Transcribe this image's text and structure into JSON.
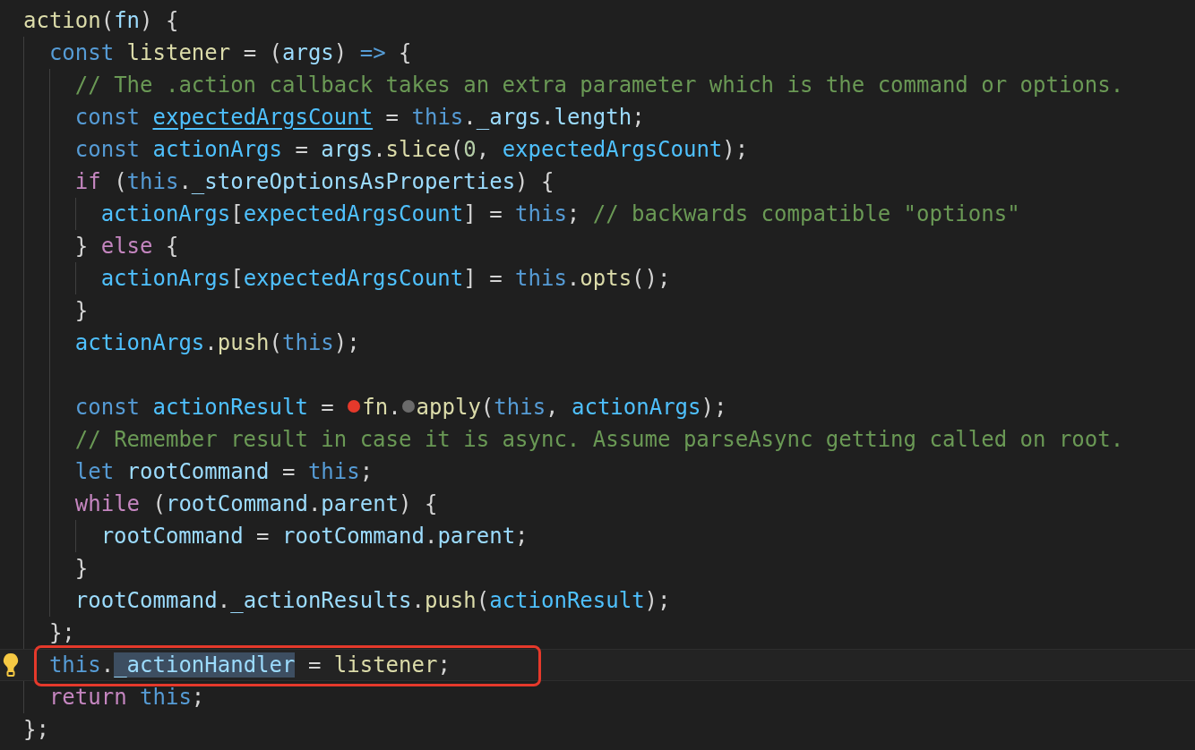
{
  "editor": {
    "lines": [
      {
        "tokens": [
          {
            "text": "action",
            "kind": "fn"
          },
          {
            "text": "(",
            "kind": "punc"
          },
          {
            "text": "fn",
            "kind": "var"
          },
          {
            "text": ") {",
            "kind": "punc"
          }
        ],
        "children": [
          {
            "tokens": [
              {
                "text": "const ",
                "kind": "kw"
              },
              {
                "text": "listener",
                "kind": "fn"
              },
              {
                "text": " = (",
                "kind": "punc"
              },
              {
                "text": "args",
                "kind": "var"
              },
              {
                "text": ") ",
                "kind": "punc"
              },
              {
                "text": "=>",
                "kind": "kw"
              },
              {
                "text": " {",
                "kind": "punc"
              }
            ],
            "children": [
              {
                "tokens": [
                  {
                    "text": "// The .action callback takes an extra parameter which is the command or options.",
                    "kind": "cmt"
                  }
                ]
              },
              {
                "tokens": [
                  {
                    "text": "const ",
                    "kind": "kw"
                  },
                  {
                    "text": "expectedArgsCount",
                    "kind": "const",
                    "underlined": true
                  },
                  {
                    "text": " = ",
                    "kind": "punc"
                  },
                  {
                    "text": "this",
                    "kind": "kw"
                  },
                  {
                    "text": ".",
                    "kind": "punc"
                  },
                  {
                    "text": "_args",
                    "kind": "var"
                  },
                  {
                    "text": ".",
                    "kind": "punc"
                  },
                  {
                    "text": "length",
                    "kind": "var"
                  },
                  {
                    "text": ";",
                    "kind": "punc"
                  }
                ]
              },
              {
                "tokens": [
                  {
                    "text": "const ",
                    "kind": "kw"
                  },
                  {
                    "text": "actionArgs",
                    "kind": "const"
                  },
                  {
                    "text": " = ",
                    "kind": "punc"
                  },
                  {
                    "text": "args",
                    "kind": "var"
                  },
                  {
                    "text": ".",
                    "kind": "punc"
                  },
                  {
                    "text": "slice",
                    "kind": "fn"
                  },
                  {
                    "text": "(",
                    "kind": "punc"
                  },
                  {
                    "text": "0",
                    "kind": "num"
                  },
                  {
                    "text": ", ",
                    "kind": "punc"
                  },
                  {
                    "text": "expectedArgsCount",
                    "kind": "const"
                  },
                  {
                    "text": ");",
                    "kind": "punc"
                  }
                ]
              },
              {
                "tokens": [
                  {
                    "text": "if",
                    "kind": "ctl"
                  },
                  {
                    "text": " (",
                    "kind": "punc"
                  },
                  {
                    "text": "this",
                    "kind": "kw"
                  },
                  {
                    "text": ".",
                    "kind": "punc"
                  },
                  {
                    "text": "_storeOptionsAsProperties",
                    "kind": "var"
                  },
                  {
                    "text": ") {",
                    "kind": "punc"
                  }
                ],
                "children": [
                  {
                    "tokens": [
                      {
                        "text": "actionArgs",
                        "kind": "const"
                      },
                      {
                        "text": "[",
                        "kind": "punc"
                      },
                      {
                        "text": "expectedArgsCount",
                        "kind": "const"
                      },
                      {
                        "text": "] = ",
                        "kind": "punc"
                      },
                      {
                        "text": "this",
                        "kind": "kw"
                      },
                      {
                        "text": "; ",
                        "kind": "punc"
                      },
                      {
                        "text": "// backwards compatible \"options\"",
                        "kind": "cmt"
                      }
                    ]
                  }
                ]
              },
              {
                "tokens": [
                  {
                    "text": "} ",
                    "kind": "punc"
                  },
                  {
                    "text": "else",
                    "kind": "ctl"
                  },
                  {
                    "text": " {",
                    "kind": "punc"
                  }
                ],
                "children": [
                  {
                    "tokens": [
                      {
                        "text": "actionArgs",
                        "kind": "const"
                      },
                      {
                        "text": "[",
                        "kind": "punc"
                      },
                      {
                        "text": "expectedArgsCount",
                        "kind": "const"
                      },
                      {
                        "text": "] = ",
                        "kind": "punc"
                      },
                      {
                        "text": "this",
                        "kind": "kw"
                      },
                      {
                        "text": ".",
                        "kind": "punc"
                      },
                      {
                        "text": "opts",
                        "kind": "fn"
                      },
                      {
                        "text": "();",
                        "kind": "punc"
                      }
                    ]
                  }
                ]
              },
              {
                "tokens": [
                  {
                    "text": "}",
                    "kind": "punc"
                  }
                ]
              },
              {
                "tokens": [
                  {
                    "text": "actionArgs",
                    "kind": "const"
                  },
                  {
                    "text": ".",
                    "kind": "punc"
                  },
                  {
                    "text": "push",
                    "kind": "fn"
                  },
                  {
                    "text": "(",
                    "kind": "punc"
                  },
                  {
                    "text": "this",
                    "kind": "kw"
                  },
                  {
                    "text": ");",
                    "kind": "punc"
                  }
                ]
              },
              {
                "blank": true
              },
              {
                "tokens": [
                  {
                    "text": "const ",
                    "kind": "kw"
                  },
                  {
                    "text": "actionResult",
                    "kind": "const"
                  },
                  {
                    "text": " = ",
                    "kind": "punc"
                  },
                  {
                    "kind": "marker",
                    "color": "#e5392b"
                  },
                  {
                    "text": "fn",
                    "kind": "fn"
                  },
                  {
                    "text": ".",
                    "kind": "punc"
                  },
                  {
                    "kind": "marker",
                    "color": "#6b6b6b"
                  },
                  {
                    "text": "apply",
                    "kind": "fn"
                  },
                  {
                    "text": "(",
                    "kind": "punc"
                  },
                  {
                    "text": "this",
                    "kind": "kw"
                  },
                  {
                    "text": ", ",
                    "kind": "punc"
                  },
                  {
                    "text": "actionArgs",
                    "kind": "const"
                  },
                  {
                    "text": ");",
                    "kind": "punc"
                  }
                ]
              },
              {
                "tokens": [
                  {
                    "text": "// Remember result in case it is async. Assume parseAsync getting called on root.",
                    "kind": "cmt"
                  }
                ]
              },
              {
                "tokens": [
                  {
                    "text": "let ",
                    "kind": "kw"
                  },
                  {
                    "text": "rootCommand",
                    "kind": "var"
                  },
                  {
                    "text": " = ",
                    "kind": "punc"
                  },
                  {
                    "text": "this",
                    "kind": "kw"
                  },
                  {
                    "text": ";",
                    "kind": "punc"
                  }
                ]
              },
              {
                "tokens": [
                  {
                    "text": "while",
                    "kind": "ctl"
                  },
                  {
                    "text": " (",
                    "kind": "punc"
                  },
                  {
                    "text": "rootCommand",
                    "kind": "var"
                  },
                  {
                    "text": ".",
                    "kind": "punc"
                  },
                  {
                    "text": "parent",
                    "kind": "var"
                  },
                  {
                    "text": ") {",
                    "kind": "punc"
                  }
                ],
                "children": [
                  {
                    "tokens": [
                      {
                        "text": "rootCommand",
                        "kind": "var"
                      },
                      {
                        "text": " = ",
                        "kind": "punc"
                      },
                      {
                        "text": "rootCommand",
                        "kind": "var"
                      },
                      {
                        "text": ".",
                        "kind": "punc"
                      },
                      {
                        "text": "parent",
                        "kind": "var"
                      },
                      {
                        "text": ";",
                        "kind": "punc"
                      }
                    ]
                  }
                ]
              },
              {
                "tokens": [
                  {
                    "text": "}",
                    "kind": "punc"
                  }
                ]
              },
              {
                "tokens": [
                  {
                    "text": "rootCommand",
                    "kind": "var"
                  },
                  {
                    "text": ".",
                    "kind": "punc"
                  },
                  {
                    "text": "_actionResults",
                    "kind": "var"
                  },
                  {
                    "text": ".",
                    "kind": "punc"
                  },
                  {
                    "text": "push",
                    "kind": "fn"
                  },
                  {
                    "text": "(",
                    "kind": "punc"
                  },
                  {
                    "text": "actionResult",
                    "kind": "const"
                  },
                  {
                    "text": ");",
                    "kind": "punc"
                  }
                ]
              }
            ]
          },
          {
            "tokens": [
              {
                "text": "};",
                "kind": "punc"
              }
            ]
          },
          {
            "current": true,
            "lightbulb": true,
            "annotated": true,
            "tokens": [
              {
                "text": "this",
                "kind": "kw",
                "selected": false
              },
              {
                "text": ".",
                "kind": "punc",
                "selected": false
              },
              {
                "text": "_actionHandler",
                "kind": "var",
                "selected": true
              },
              {
                "text": " = ",
                "kind": "punc",
                "selected": false
              },
              {
                "text": "listener",
                "kind": "fn",
                "selected": false
              },
              {
                "text": ";",
                "kind": "punc",
                "selected": false
              }
            ]
          },
          {
            "tokens": [
              {
                "text": "return ",
                "kind": "ctl"
              },
              {
                "text": "this",
                "kind": "kw"
              },
              {
                "text": ";",
                "kind": "punc"
              }
            ]
          }
        ]
      },
      {
        "tokens": [
          {
            "text": "};",
            "kind": "punc"
          }
        ]
      }
    ]
  }
}
